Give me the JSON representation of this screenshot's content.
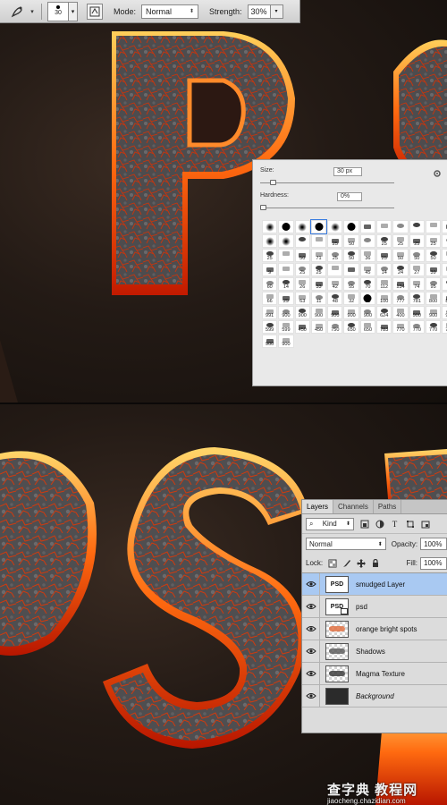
{
  "options_bar": {
    "tool_icon": "smudge-tool-icon",
    "brush_size": "30",
    "mode_label": "Mode:",
    "mode_value": "Normal",
    "strength_label": "Strength:",
    "strength_value": "30%"
  },
  "brush_picker": {
    "size_label": "Size:",
    "size_value": "30 px",
    "hardness_label": "Hardness:",
    "hardness_value": "0%",
    "size_slider_level": 0.07,
    "hardness_slider_level": 0.0,
    "tips": [
      {
        "shape": "soft",
        "num": ""
      },
      {
        "shape": "hard",
        "num": ""
      },
      {
        "shape": "soft",
        "num": ""
      },
      {
        "shape": "hard",
        "num": ""
      },
      {
        "shape": "soft",
        "num": ""
      },
      {
        "shape": "hard",
        "num": ""
      },
      {
        "shape": "brush",
        "num": ""
      },
      {
        "shape": "brush",
        "num": ""
      },
      {
        "shape": "brush",
        "num": ""
      },
      {
        "shape": "brush",
        "num": ""
      },
      {
        "shape": "brush",
        "num": ""
      },
      {
        "shape": "brush",
        "num": ""
      },
      {
        "shape": "soft",
        "num": ""
      },
      {
        "shape": "soft",
        "num": ""
      },
      {
        "shape": "brush",
        "num": ""
      },
      {
        "shape": "brush",
        "num": ""
      },
      {
        "shape": "brush",
        "num": "25"
      },
      {
        "shape": "brush",
        "num": "50"
      },
      {
        "shape": "brush",
        "num": ""
      },
      {
        "shape": "brush",
        "num": "25"
      },
      {
        "shape": "brush",
        "num": "25"
      },
      {
        "shape": "brush",
        "num": "25"
      },
      {
        "shape": "brush",
        "num": "25"
      },
      {
        "shape": "brush",
        "num": "50"
      },
      {
        "shape": "brush",
        "num": "25"
      },
      {
        "shape": "brush",
        "num": ""
      },
      {
        "shape": "brush",
        "num": "50"
      },
      {
        "shape": "brush",
        "num": "71"
      },
      {
        "shape": "brush",
        "num": "25"
      },
      {
        "shape": "brush",
        "num": "50"
      },
      {
        "shape": "brush",
        "num": "36"
      },
      {
        "shape": "brush",
        "num": "25"
      },
      {
        "shape": "brush",
        "num": "50"
      },
      {
        "shape": "brush",
        "num": "50"
      },
      {
        "shape": "brush",
        "num": "50"
      },
      {
        "shape": "brush",
        "num": "50"
      },
      {
        "shape": "brush",
        "num": "9"
      },
      {
        "shape": "brush",
        "num": ""
      },
      {
        "shape": "brush",
        "num": "25"
      },
      {
        "shape": "brush",
        "num": "25"
      },
      {
        "shape": "brush",
        "num": ""
      },
      {
        "shape": "brush",
        "num": ""
      },
      {
        "shape": "brush",
        "num": "45"
      },
      {
        "shape": "brush",
        "num": "14"
      },
      {
        "shape": "brush",
        "num": "24"
      },
      {
        "shape": "brush",
        "num": "27"
      },
      {
        "shape": "brush",
        "num": "39"
      },
      {
        "shape": "brush",
        "num": "46"
      },
      {
        "shape": "brush",
        "num": "60"
      },
      {
        "shape": "brush",
        "num": "14"
      },
      {
        "shape": "brush",
        "num": "26"
      },
      {
        "shape": "brush",
        "num": "33"
      },
      {
        "shape": "brush",
        "num": "42"
      },
      {
        "shape": "brush",
        "num": "55"
      },
      {
        "shape": "brush",
        "num": "70"
      },
      {
        "shape": "brush",
        "num": "112"
      },
      {
        "shape": "brush",
        "num": "134"
      },
      {
        "shape": "brush",
        "num": "74"
      },
      {
        "shape": "brush",
        "num": "95"
      },
      {
        "shape": "brush",
        "num": "95"
      },
      {
        "shape": "brush",
        "num": "66"
      },
      {
        "shape": "brush",
        "num": "29"
      },
      {
        "shape": "brush",
        "num": "63"
      },
      {
        "shape": "brush",
        "num": "11"
      },
      {
        "shape": "brush",
        "num": "48"
      },
      {
        "shape": "brush",
        "num": "32"
      },
      {
        "shape": "hard",
        "num": "55"
      },
      {
        "shape": "brush",
        "num": "100"
      },
      {
        "shape": "brush",
        "num": "777"
      },
      {
        "shape": "brush",
        "num": "781"
      },
      {
        "shape": "brush",
        "num": "800"
      },
      {
        "shape": "brush",
        "num": "800"
      },
      {
        "shape": "brush",
        "num": "991"
      },
      {
        "shape": "brush",
        "num": "900"
      },
      {
        "shape": "brush",
        "num": "900"
      },
      {
        "shape": "brush",
        "num": "900"
      },
      {
        "shape": "brush",
        "num": "900"
      },
      {
        "shape": "brush",
        "num": "900"
      },
      {
        "shape": "brush",
        "num": "900"
      },
      {
        "shape": "brush",
        "num": "624"
      },
      {
        "shape": "brush",
        "num": "400"
      },
      {
        "shape": "brush",
        "num": "900"
      },
      {
        "shape": "brush",
        "num": "900"
      },
      {
        "shape": "brush",
        "num": "900"
      },
      {
        "shape": "brush",
        "num": "599"
      },
      {
        "shape": "brush",
        "num": "599"
      },
      {
        "shape": "brush",
        "num": "450"
      },
      {
        "shape": "brush",
        "num": "450"
      },
      {
        "shape": "brush",
        "num": "750"
      },
      {
        "shape": "brush",
        "num": "650"
      },
      {
        "shape": "brush",
        "num": "650"
      },
      {
        "shape": "brush",
        "num": "783"
      },
      {
        "shape": "brush",
        "num": "770"
      },
      {
        "shape": "brush",
        "num": "770"
      },
      {
        "shape": "brush",
        "num": "770"
      },
      {
        "shape": "brush",
        "num": "770"
      },
      {
        "shape": "brush",
        "num": "900"
      },
      {
        "shape": "brush",
        "num": "900"
      }
    ]
  },
  "layers_panel": {
    "tabs": [
      {
        "label": "Layers",
        "active": true
      },
      {
        "label": "Channels",
        "active": false
      },
      {
        "label": "Paths",
        "active": false
      }
    ],
    "kind_label": "Kind",
    "blend_mode": "Normal",
    "opacity_label": "Opacity:",
    "opacity_value": "100%",
    "lock_label": "Lock:",
    "fill_label": "Fill:",
    "fill_value": "100%",
    "layers": [
      {
        "name": "smudged Layer",
        "thumb": "psd",
        "active": true,
        "italic": false
      },
      {
        "name": "psd",
        "thumb": "psd-smart",
        "active": false,
        "italic": false
      },
      {
        "name": "orange bright spots",
        "thumb": "checker",
        "active": false,
        "italic": false
      },
      {
        "name": "Shadows",
        "thumb": "checker-dark",
        "active": false,
        "italic": false
      },
      {
        "name": "Magma Texture",
        "thumb": "checker-texture",
        "active": false,
        "italic": false
      },
      {
        "name": "Background",
        "thumb": "dark",
        "active": false,
        "italic": true
      }
    ],
    "thumb_label": "PSD"
  },
  "watermark": {
    "cn_text": "查字典 教程网",
    "url_text": "jiaocheng.chazidian.com"
  },
  "colors": {
    "lava_orange": "#ff7a1a",
    "rock_gray": "#4a4a4c",
    "selection_blue": "#a9c9f2"
  }
}
